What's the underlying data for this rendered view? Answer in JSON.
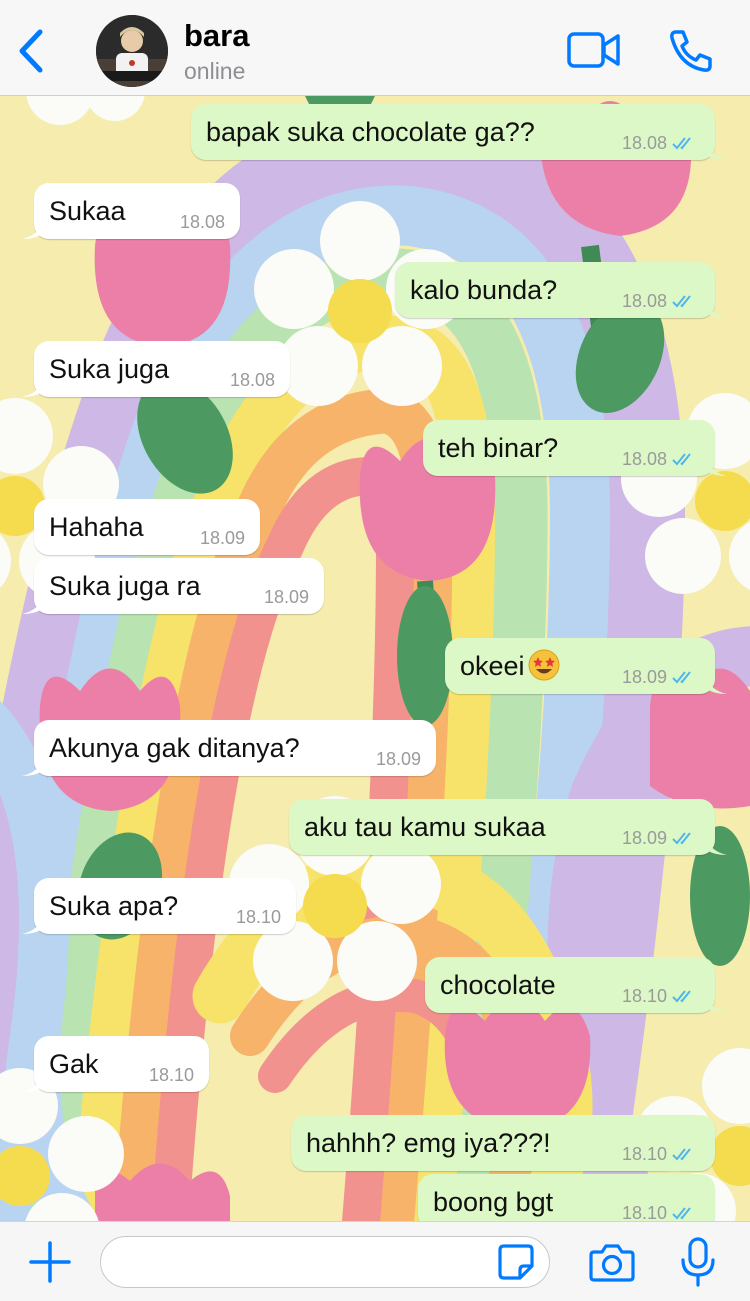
{
  "header": {
    "contact_name": "bara",
    "contact_status": "online"
  },
  "colors": {
    "accent": "#007aff",
    "outgoing_bubble": "#dcf8c6",
    "incoming_bubble": "#ffffff",
    "read_ticks": "#4fb6ec"
  },
  "icons": {
    "back": "chevron-left-icon",
    "video": "video-camera-icon",
    "call": "phone-icon",
    "add": "plus-icon",
    "sticker": "sticker-icon",
    "camera": "camera-icon",
    "mic": "microphone-icon"
  },
  "messages": [
    {
      "dir": "out",
      "text": "bapak suka chocolate ga??",
      "time": "18.08",
      "status": "read"
    },
    {
      "dir": "in",
      "text": "Sukaa",
      "time": "18.08"
    },
    {
      "dir": "out",
      "text": "kalo bunda?",
      "time": "18.08",
      "status": "read"
    },
    {
      "dir": "in",
      "text": "Suka juga",
      "time": "18.08"
    },
    {
      "dir": "out",
      "text": "teh binar?",
      "time": "18.08",
      "status": "read"
    },
    {
      "dir": "in",
      "text": "Hahaha",
      "time": "18.09"
    },
    {
      "dir": "in",
      "text": "Suka juga ra",
      "time": "18.09"
    },
    {
      "dir": "out",
      "text": "okeei",
      "time": "18.09",
      "status": "read",
      "emoji": "star-struck-emoji"
    },
    {
      "dir": "in",
      "text": "Akunya gak ditanya?",
      "time": "18.09"
    },
    {
      "dir": "out",
      "text": "aku tau kamu sukaa",
      "time": "18.09",
      "status": "read"
    },
    {
      "dir": "in",
      "text": "Suka apa?",
      "time": "18.10"
    },
    {
      "dir": "out",
      "text": "chocolate",
      "time": "18.10",
      "status": "read"
    },
    {
      "dir": "in",
      "text": "Gak",
      "time": "18.10"
    },
    {
      "dir": "out",
      "text": "hahhh? emg iya???!",
      "time": "18.10",
      "status": "read"
    },
    {
      "dir": "out",
      "text": "boong bgt",
      "time": "18.10",
      "status": "read"
    }
  ],
  "composer": {
    "value": "",
    "placeholder": ""
  }
}
